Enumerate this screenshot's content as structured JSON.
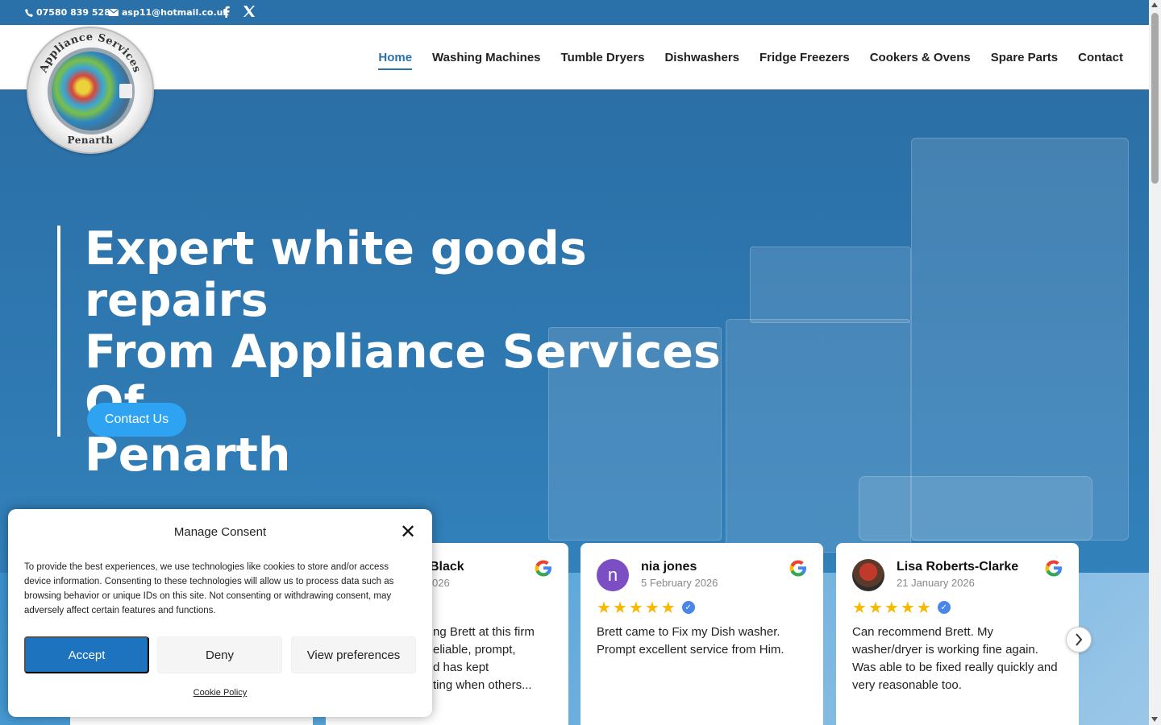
{
  "topbar": {
    "phone": "07580 839 528",
    "email": "asp11@hotmail.co.uk",
    "social": [
      "facebook-icon",
      "x-icon"
    ]
  },
  "logo": {
    "arc_text": "Appliance Services",
    "town": "Penarth"
  },
  "nav": {
    "items": [
      {
        "label": "Home",
        "active": true
      },
      {
        "label": "Washing Machines"
      },
      {
        "label": "Tumble Dryers"
      },
      {
        "label": "Dishwashers"
      },
      {
        "label": "Fridge Freezers"
      },
      {
        "label": "Cookers & Ovens"
      },
      {
        "label": "Spare Parts"
      },
      {
        "label": "Contact"
      }
    ]
  },
  "hero": {
    "heading_line1": "Expert white goods repairs",
    "heading_line2": "From Appliance Services Of",
    "heading_line3": "Penarth",
    "cta_label": "Contact Us"
  },
  "reviews": [
    {
      "name_visible": "Black",
      "date_visible": "026",
      "text_lines": [
        "ng Brett at this firm",
        "eliable, prompt,",
        "d has kept",
        "ting when others..."
      ]
    },
    {
      "initial": "n",
      "name": "nia jones",
      "date": "5 February 2026",
      "avatar_color": "#7b4ec3",
      "text": "Brett came to Fix my Dish washer. Prompt excellent service from Him."
    },
    {
      "name": "Lisa Roberts-Clarke",
      "date": "21 January 2026",
      "text": "Can recommend Brett. My washer/dryer is working fine again. Was able to be fixed really quickly and very reasonable too."
    }
  ],
  "rating_stars": 5,
  "consent": {
    "title": "Manage Consent",
    "message": "To provide the best experiences, we use technologies like cookies to store and/or access device information. Consenting to these technologies will allow us to process data such as browsing behavior or unique IDs on this site. Not consenting or withdrawing consent, may adversely affect certain features and functions.",
    "accept": "Accept",
    "deny": "Deny",
    "preferences": "View preferences",
    "policy_link": "Cookie Policy"
  },
  "colors": {
    "brand_blue": "#2b71a9",
    "cta_blue": "#2ea3f2",
    "accept_blue": "#1e73be",
    "star_gold": "#f8b802"
  }
}
